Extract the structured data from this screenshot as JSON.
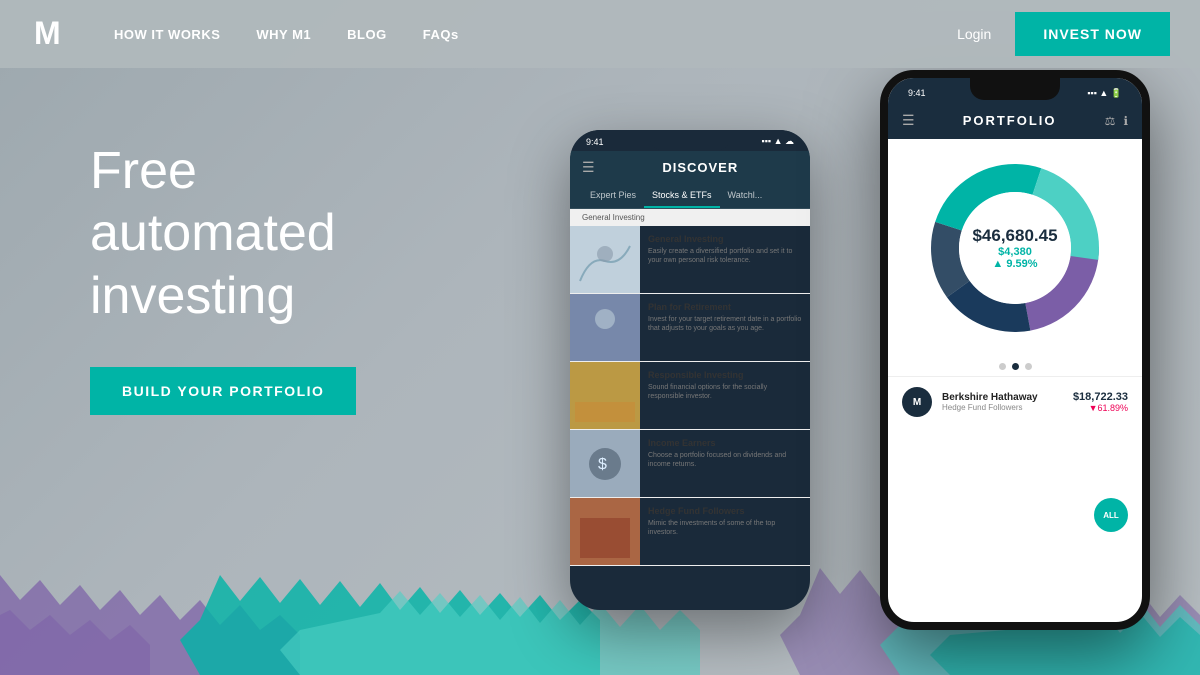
{
  "navbar": {
    "logo_text": "M",
    "links": [
      {
        "label": "HOW IT WORKS",
        "id": "how-it-works"
      },
      {
        "label": "WHY M1",
        "id": "why-m1"
      },
      {
        "label": "BLOG",
        "id": "blog"
      },
      {
        "label": "FAQs",
        "id": "faqs"
      }
    ],
    "login_label": "Login",
    "invest_label": "INVEST NOW"
  },
  "hero": {
    "title_line1": "Free",
    "title_line2": "automated",
    "title_line3": "investing",
    "cta_label": "BUILD YOUR PORTFOLIO"
  },
  "phone1": {
    "time": "9:41",
    "screen_title": "DISCOVER",
    "tabs": [
      "Expert Pies",
      "Stocks & ETFs",
      "Watchl..."
    ],
    "subheader": "General Investing",
    "items": [
      {
        "title": "General Investing",
        "desc": "Easily create a diversified portfolio and set it to your own personal risk tolerance."
      },
      {
        "title": "Plan for Retirement",
        "desc": "Invest for your target retirement date in a portfolio that adjusts to your goals as you age."
      },
      {
        "title": "Responsible Investing",
        "desc": "Sound financial options for the socially responsible investor."
      },
      {
        "title": "Income Earners",
        "desc": "Choose a portfolio focused on dividends and income returns."
      },
      {
        "title": "Hedge Fund Followers",
        "desc": "Mimic the investments of some of the top investors."
      }
    ]
  },
  "phone2": {
    "time": "9:41",
    "screen_title": "PORTFOLIO",
    "portfolio_value": "$46,680.45",
    "portfolio_change": "$4,380",
    "portfolio_pct": "▲ 9.59%",
    "all_label": "ALL",
    "dots": [
      false,
      true,
      false
    ],
    "card": {
      "avatar": "M",
      "name": "Berkshire Hathaway",
      "sub": "Hedge Fund Followers",
      "amount": "$18,722.33",
      "pct": "▼61.89%"
    }
  },
  "chart": {
    "segments": [
      {
        "color": "#7b5ea7",
        "pct": 22
      },
      {
        "color": "#1a3a5c",
        "pct": 18
      },
      {
        "color": "#334d66",
        "pct": 15
      },
      {
        "color": "#00b4a6",
        "pct": 25
      },
      {
        "color": "#4dd0c4",
        "pct": 20
      }
    ]
  }
}
